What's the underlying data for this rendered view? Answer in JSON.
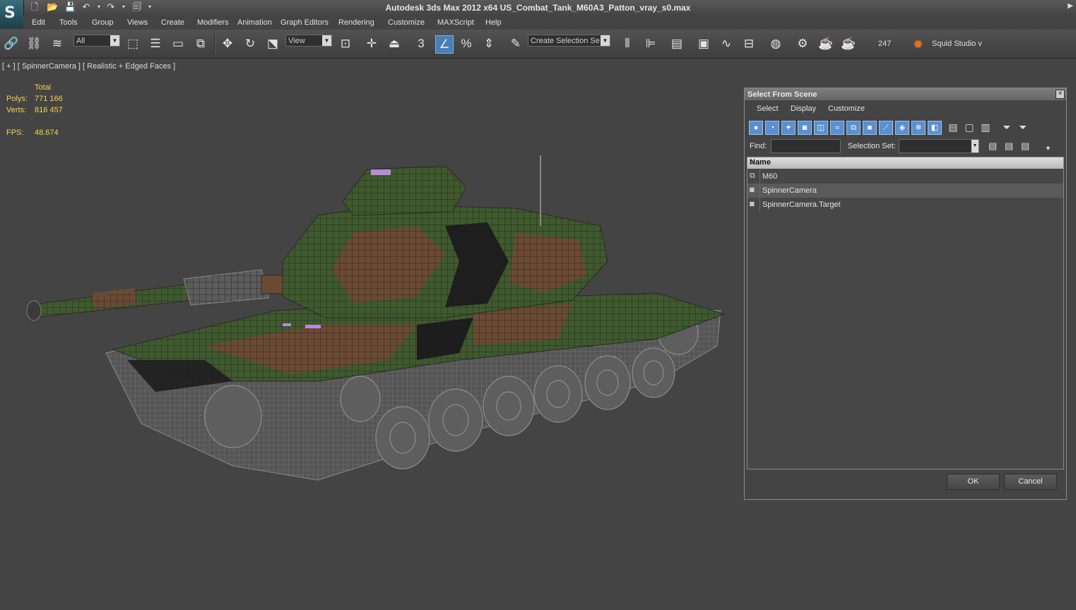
{
  "window": {
    "title": "Autodesk 3ds Max  2012 x64     US_Combat_Tank_M60A3_Patton_vray_s0.max"
  },
  "menu": [
    "Edit",
    "Tools",
    "Group",
    "Views",
    "Create",
    "Modifiers",
    "Animation",
    "Graph Editors",
    "Rendering",
    "Customize",
    "MAXScript",
    "Help"
  ],
  "toolbar": {
    "filter_value": "All",
    "coord_value": "View",
    "snap_label": "3",
    "selection_set_value": "Create Selection Se",
    "count_label": "247",
    "plugin_label": "Squid Studio v"
  },
  "viewport": {
    "label": "[ + ] [ SpinnerCamera ] [ Realistic + Edged Faces ]",
    "stats": {
      "total_label": "Total",
      "polys_label": "Polys:",
      "polys_value": "771 166",
      "verts_label": "Verts:",
      "verts_value": "816 457",
      "fps_label": "FPS:",
      "fps_value": "48.674"
    }
  },
  "dialog": {
    "title": "Select From Scene",
    "menu": [
      "Select",
      "Display",
      "Customize"
    ],
    "find_label": "Find:",
    "find_value": "",
    "selection_set_label": "Selection Set:",
    "list_header": "Name",
    "items": [
      {
        "name": "M60",
        "icon": "group-icon",
        "selected": false
      },
      {
        "name": "SpinnerCamera",
        "icon": "camera-icon",
        "selected": true
      },
      {
        "name": "SpinnerCamera.Target",
        "icon": "camera-target-icon",
        "selected": false
      }
    ],
    "ok_label": "OK",
    "cancel_label": "Cancel"
  },
  "colors": {
    "accent": "#4a7eb5",
    "stats_text": "#f4d44a",
    "viewport_bg": "#444444"
  }
}
